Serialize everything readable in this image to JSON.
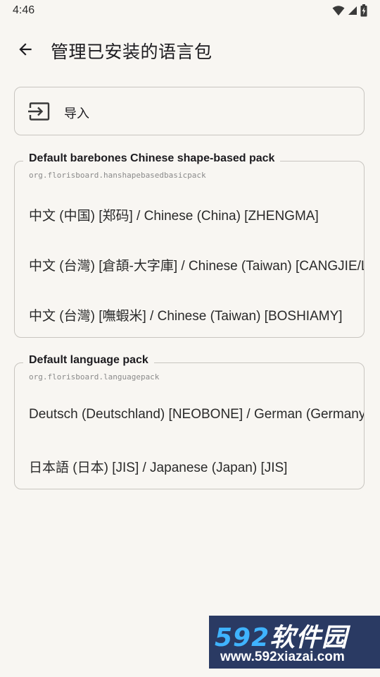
{
  "status_bar": {
    "time": "4:46",
    "icons": [
      "wifi-icon",
      "cellular-icon",
      "battery-charging-icon"
    ]
  },
  "app_bar": {
    "back_icon": "arrow-back-icon",
    "title": "管理已安装的语言包"
  },
  "import_card": {
    "icon": "import-icon",
    "label": "导入"
  },
  "groups": [
    {
      "title": "Default barebones Chinese shape-based pack",
      "id": "org.florisboard.hanshapebasedbasicpack",
      "items": [
        "中文 (中国) [郑码] / Chinese (China) [ZHENGMA]",
        "中文 (台灣) [倉頡-大字庫] / Chinese (Taiwan) [CANGJIE/LARGE]",
        "中文 (台灣) [嘸蝦米] / Chinese (Taiwan) [BOSHIAMY]"
      ]
    },
    {
      "title": "Default language pack",
      "id": "org.florisboard.languagepack",
      "items": [
        "Deutsch (Deutschland) [NEOBONE] / German (Germany) [NEOBONE]",
        "日本語 (日本) [JIS] / Japanese (Japan) [JIS]"
      ]
    }
  ],
  "watermark": {
    "brand_num": "592",
    "brand_text": "软件园",
    "url": "www.592xiazai.com"
  },
  "colors": {
    "background": "#f8f6f2",
    "border": "#c8c5c0",
    "text": "#1c1b1f",
    "secondary_text": "#8a8a8a"
  }
}
